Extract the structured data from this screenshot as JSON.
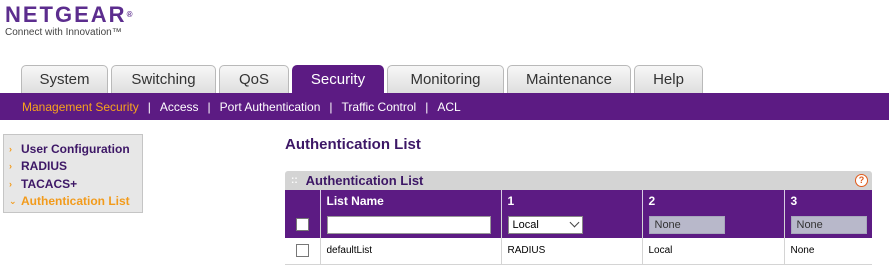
{
  "brand": {
    "name": "NETGEAR",
    "reg": "®",
    "tagline": "Connect with Innovation™"
  },
  "tabs": [
    {
      "label": "System",
      "active": false
    },
    {
      "label": "Switching",
      "active": false
    },
    {
      "label": "QoS",
      "active": false
    },
    {
      "label": "Security",
      "active": true
    },
    {
      "label": "Monitoring",
      "active": false
    },
    {
      "label": "Maintenance",
      "active": false
    },
    {
      "label": "Help",
      "active": false
    }
  ],
  "subnav": [
    {
      "label": "Management Security",
      "active": true
    },
    {
      "label": "Access",
      "active": false
    },
    {
      "label": "Port Authentication",
      "active": false
    },
    {
      "label": "Traffic Control",
      "active": false
    },
    {
      "label": "ACL",
      "active": false
    }
  ],
  "sidebar": [
    {
      "label": "User Configuration",
      "active": false
    },
    {
      "label": "RADIUS",
      "active": false
    },
    {
      "label": "TACACS+",
      "active": false
    },
    {
      "label": "Authentication List",
      "active": true
    }
  ],
  "page_title": "Authentication List",
  "panel": {
    "title": "Authentication List",
    "help": "?",
    "columns": [
      "",
      "List Name",
      "1",
      "2",
      "3"
    ],
    "edit_row": {
      "list_name_value": "",
      "method1": "Local",
      "method2": "None",
      "method3": "None"
    },
    "rows": [
      {
        "name": "defaultList",
        "m1": "RADIUS",
        "m2": "Local",
        "m3": "None"
      }
    ]
  },
  "colors": {
    "brand_purple": "#5c1b83",
    "accent_orange": "#f29b1c"
  }
}
